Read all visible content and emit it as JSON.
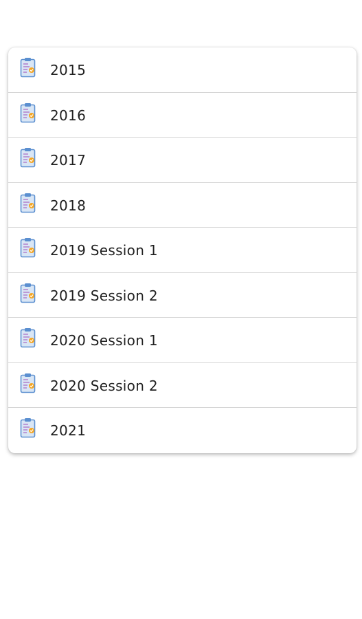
{
  "list": {
    "items": [
      {
        "label": "2015",
        "icon": "clipboard-icon"
      },
      {
        "label": "2016",
        "icon": "clipboard-icon"
      },
      {
        "label": "2017",
        "icon": "clipboard-icon"
      },
      {
        "label": "2018",
        "icon": "clipboard-icon"
      },
      {
        "label": "2019 Session 1",
        "icon": "clipboard-icon"
      },
      {
        "label": "2019 Session 2",
        "icon": "clipboard-icon"
      },
      {
        "label": "2020 Session 1",
        "icon": "clipboard-icon"
      },
      {
        "label": "2020 Session 2",
        "icon": "clipboard-icon"
      },
      {
        "label": "2021",
        "icon": "clipboard-icon"
      }
    ]
  },
  "colors": {
    "icon_board": "#d9e6f5",
    "icon_border": "#5b8fd0",
    "icon_lines": "#b07ac9",
    "icon_accent": "#f5a623",
    "text": "#1f1f1f",
    "divider": "#d6d6d6"
  }
}
